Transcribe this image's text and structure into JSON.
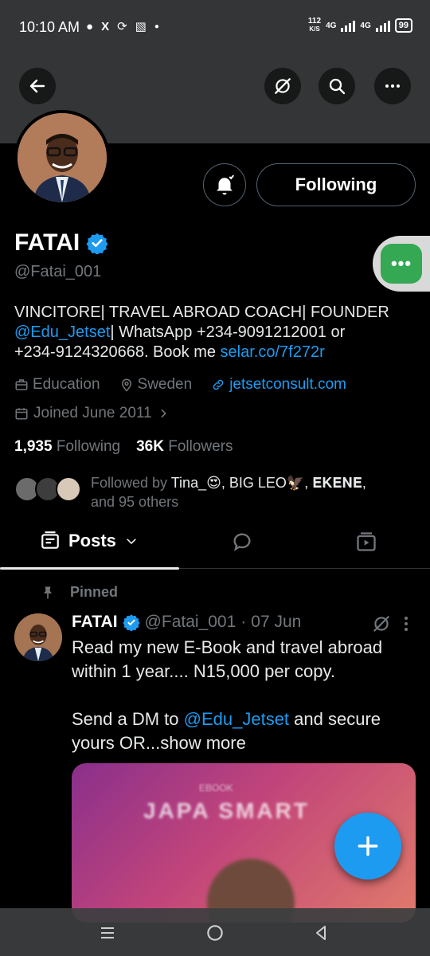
{
  "status_bar": {
    "time": "10:10 AM",
    "net_speed_value": "112",
    "net_speed_unit": "K/S",
    "signal_label_1": "4G",
    "signal_label_2": "4G",
    "battery": "99"
  },
  "profile": {
    "name": "FATAI",
    "handle": "@Fatai_001",
    "following_button": "Following",
    "bio": {
      "line1": "VINCITORE| TRAVEL ABROAD COACH| FOUNDER",
      "mention": "@Edu_Jetset",
      "line2_rest": "| WhatsApp +234-9091212001 or",
      "line3_start": "+234-9124320668. Book me ",
      "link": "selar.co/7f272r"
    },
    "category": "Education",
    "location": "Sweden",
    "website": "jetsetconsult.com",
    "joined": "Joined June 2011",
    "following_count": "1,935",
    "following_label": "Following",
    "followers_count": "36K",
    "followers_label": "Followers",
    "followed_by_prefix": "Followed by ",
    "followed_by_names": "Tina_😍, BIG LEO🦅, 𝐄𝐊𝐄𝐍𝐄,",
    "followed_by_suffix": "and 95 others"
  },
  "tabs": {
    "posts_label": "Posts"
  },
  "pinned_post": {
    "pinned_label": "Pinned",
    "author_name": "FATAI",
    "author_handle": "@Fatai_001",
    "separator": "·",
    "date": "07 Jun",
    "text_line1": "Read my new E-Book and travel abroad",
    "text_line2": "within 1 year.... N15,000 per copy.",
    "text_line3_start": "Send a DM to ",
    "text_mention": "@Edu_Jetset",
    "text_line3_end": " and secure",
    "text_line4": "yours OR...show more",
    "media_title": "JAPA SMART",
    "media_sub": "EBOOK"
  },
  "colors": {
    "accent": "#1d9bf0",
    "verified": "#1d9bf0",
    "muted": "#71767b",
    "background": "#000000",
    "banner": "#333537"
  },
  "icons": [
    "back-arrow-icon",
    "grok-icon",
    "search-icon",
    "more-icon",
    "bell-icon",
    "verified-icon",
    "briefcase-icon",
    "location-icon",
    "link-icon",
    "calendar-icon",
    "chevron-right-icon",
    "chevron-down-icon",
    "chat-bubble-icon",
    "video-icon",
    "pin-icon",
    "plus-icon",
    "menu-icon",
    "home-circle-icon",
    "back-triangle-icon"
  ]
}
